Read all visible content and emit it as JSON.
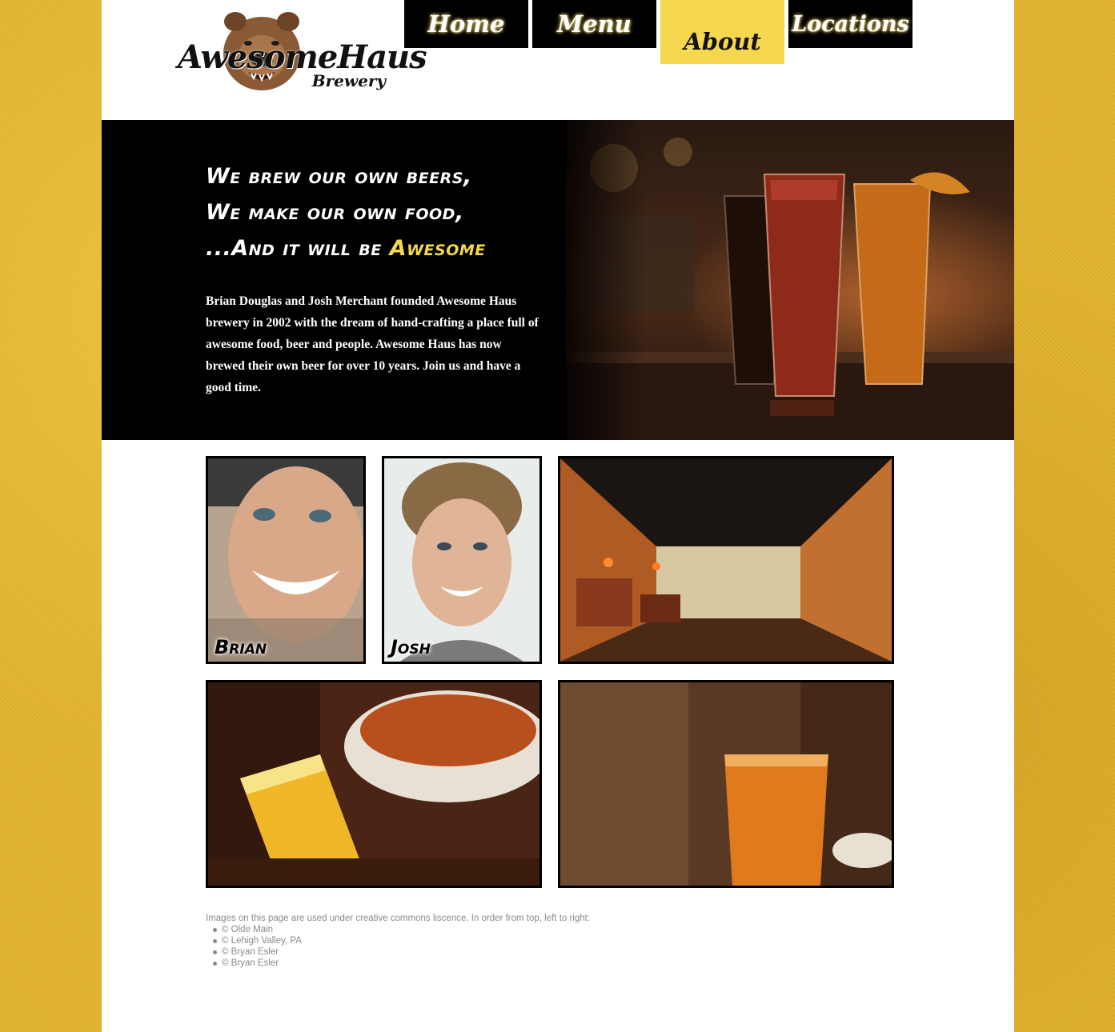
{
  "brand": {
    "name": "AwesomeHaus",
    "sub": "Brewery"
  },
  "nav": [
    {
      "label": "Home",
      "active": false
    },
    {
      "label": "Menu",
      "active": false
    },
    {
      "label": "About",
      "active": true
    },
    {
      "label": "Locations",
      "active": false
    }
  ],
  "hero": {
    "line1": "We brew our own beers,",
    "line2": "We make our own food,",
    "line3_prefix": "...And it will be ",
    "line3_highlight": "Awesome",
    "body": "Brian Douglas and Josh Merchant founded Awesome Haus brewery in 2002 with the dream of hand-crafting a place full of awesome food, beer and people. Awesome Haus has now brewed their own beer for over 10 years. Join us and have a good time."
  },
  "gallery": {
    "brian_caption": "Brian",
    "josh_caption": "Josh"
  },
  "credits": {
    "intro": "Images on this page are used under creative commons liscence. In order from top, left to right:",
    "items": [
      "© Olde Main",
      "© Lehigh Valley, PA",
      "© Bryan Esler",
      "© Bryan Esler"
    ]
  },
  "colors": {
    "accent": "#f5d84e",
    "background": "#e2b42e",
    "nav_bg": "#000000"
  }
}
